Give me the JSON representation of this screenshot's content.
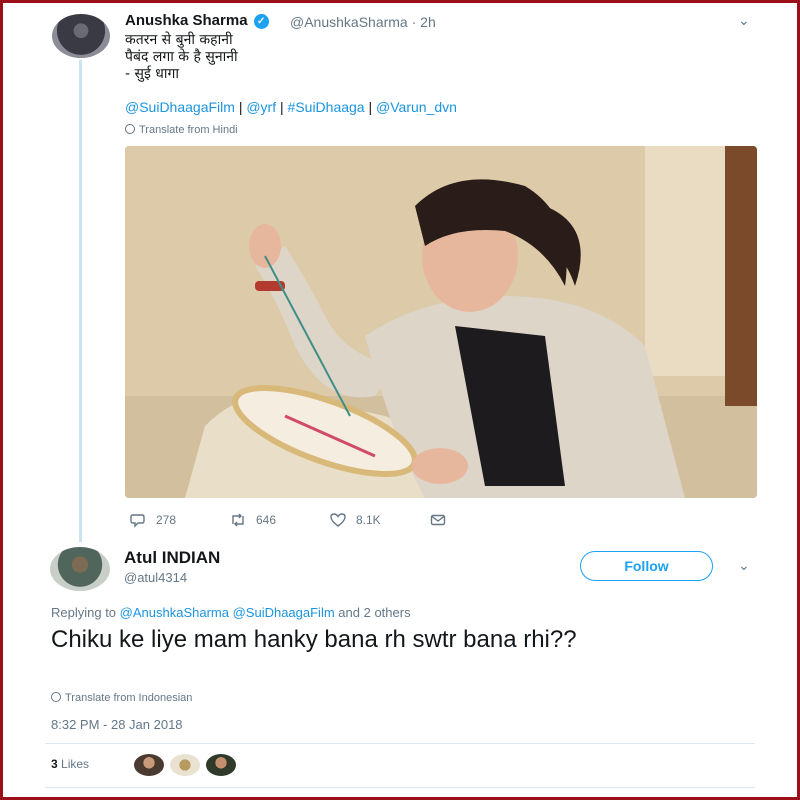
{
  "tweet": {
    "author_name": "Anushka Sharma",
    "handle": "@AnushkaSharma",
    "time": "· 2h",
    "text_lines": [
      "कतरन से बुनी कहानी",
      "पैबंद लगा के है सुनानी",
      "- सुई धागा"
    ],
    "tags": [
      "@SuiDhaagaFilm",
      "@yrf",
      "#SuiDhaaga",
      "@Varun_dvn"
    ],
    "tag_separator": "|",
    "translate": "Translate from Hindi",
    "stats": {
      "replies": "278",
      "retweets": "646",
      "likes": "8.1K"
    }
  },
  "reply": {
    "author_name": "Atul INDIAN",
    "handle": "@atul4314",
    "follow_label": "Follow",
    "replying_prefix": "Replying to",
    "replying_mentions": "@AnushkaSharma @SuiDhaagaFilm",
    "replying_suffix": "and 2 others",
    "text": "Chiku ke liye mam hanky bana rh swtr bana rhi??",
    "translate": "Translate from Indonesian",
    "timestamp": "8:32 PM - 28 Jan 2018",
    "likes_count": "3",
    "likes_label": "Likes"
  },
  "icons": [
    "reply-icon",
    "retweet-icon",
    "heart-icon",
    "dm-icon",
    "chevron-down-icon",
    "verified-badge-icon",
    "globe-icon"
  ],
  "colors": {
    "accent": "#1da1f2",
    "link": "#1b95e0",
    "frame": "#9b0f1a",
    "muted": "#657786",
    "thread_line": "#c9e4f3"
  }
}
